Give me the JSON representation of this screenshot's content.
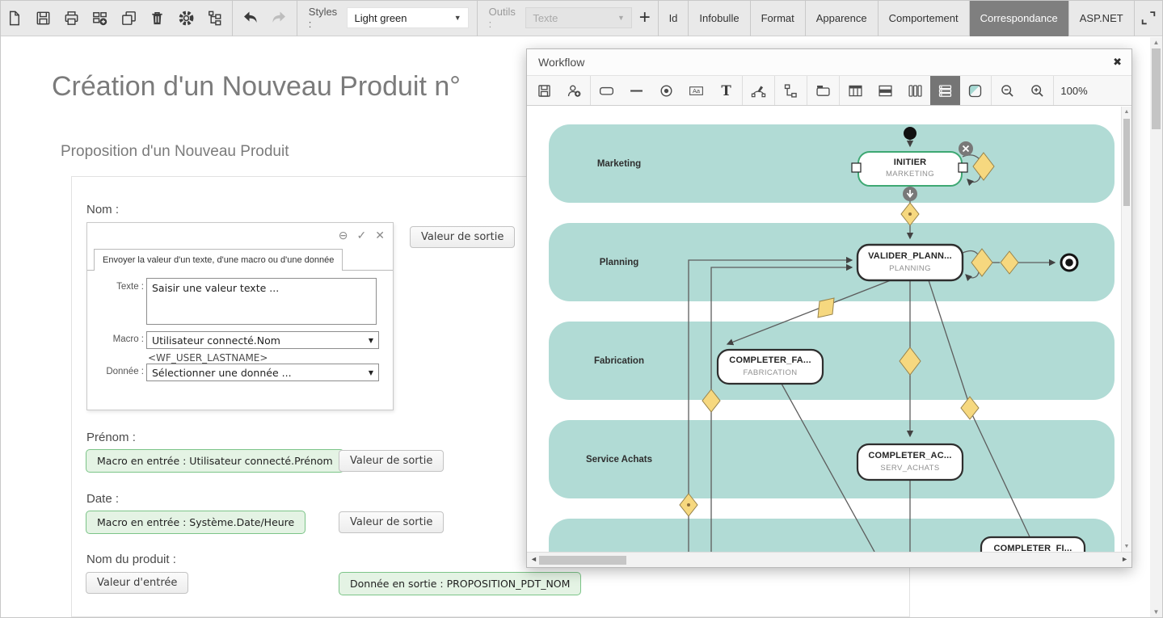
{
  "toolbar": {
    "styles_label": "Styles :",
    "styles_value": "Light green",
    "outils_label": "Outils :",
    "outils_placeholder": "Texte",
    "add_label": "+",
    "tabs": [
      "Id",
      "Infobulle",
      "Format",
      "Apparence",
      "Comportement",
      "Correspondance",
      "ASP.NET"
    ],
    "active_tab": "Correspondance",
    "icons": [
      "new-document",
      "save",
      "print",
      "add-fields",
      "duplicate",
      "delete",
      "settings",
      "tree-view",
      "undo",
      "redo",
      "expand"
    ]
  },
  "page": {
    "title": "Création d'un Nouveau Produit n°",
    "section_title": "Proposition d'un Nouveau Produit"
  },
  "form": {
    "nom": {
      "label": "Nom :",
      "tab": "Envoyer la valeur d'un texte, d'une macro ou d'une donnée",
      "texte_label": "Texte :",
      "texte_value": "Saisir une valeur texte ...",
      "macro_label": "Macro :",
      "macro_value": "Utilisateur connecté.Nom",
      "macro_token": "<WF_USER_LASTNAME>",
      "donnee_label": "Donnée :",
      "donnee_value": "Sélectionner une donnée ...",
      "output_button": "Valeur de sortie"
    },
    "prenom": {
      "label": "Prénom :",
      "badge": "Macro en entrée : Utilisateur connecté.Prénom",
      "output_button": "Valeur de sortie"
    },
    "date": {
      "label": "Date :",
      "badge": "Macro en entrée : Système.Date/Heure",
      "output_button": "Valeur de sortie"
    },
    "produit": {
      "label": "Nom du produit :",
      "input_button": "Valeur d'entrée",
      "badge": "Donnée en sortie : PROPOSITION_PDT_NOM"
    }
  },
  "workflow": {
    "title": "Workflow",
    "zoom_level": "100%",
    "lanes": [
      "Marketing",
      "Planning",
      "Fabrication",
      "Service Achats"
    ],
    "nodes": [
      {
        "title": "INITIER",
        "subtitle": "MARKETING"
      },
      {
        "title": "VALIDER_PLANN...",
        "subtitle": "PLANNING"
      },
      {
        "title": "COMPLETER_FA...",
        "subtitle": "FABRICATION"
      },
      {
        "title": "COMPLETER_AC...",
        "subtitle": "SERV_ACHATS"
      },
      {
        "title": "COMPLETER_FI...",
        "subtitle": ""
      }
    ]
  },
  "colors": {
    "lane": "#b1dbd5",
    "node_accent": "#3ea873",
    "diamond": "#f6d87f",
    "badge_bg": "#e4f3e4",
    "badge_border": "#7cc488",
    "active_tab": "#7f7f7f"
  }
}
